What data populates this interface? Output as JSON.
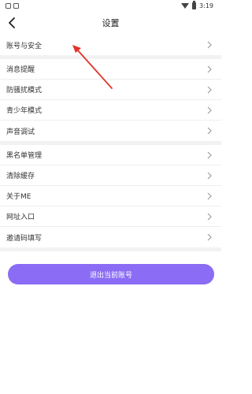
{
  "status_bar": {
    "time": "3:19"
  },
  "header": {
    "title": "设置"
  },
  "groups": [
    {
      "items": [
        {
          "label": "账号与安全"
        }
      ]
    },
    {
      "items": [
        {
          "label": "消息提醒"
        },
        {
          "label": "防骚扰模式"
        },
        {
          "label": "青少年模式"
        },
        {
          "label": "声音调试"
        }
      ]
    },
    {
      "items": [
        {
          "label": "黑名单管理"
        },
        {
          "label": "清除缓存"
        },
        {
          "label": "关于ME"
        },
        {
          "label": "网址入口"
        },
        {
          "label": "邀请码填写"
        }
      ]
    }
  ],
  "logout_button": {
    "label": "退出当前账号",
    "color": "#8a6cf5"
  },
  "annotation": {
    "color": "#e0342a"
  }
}
